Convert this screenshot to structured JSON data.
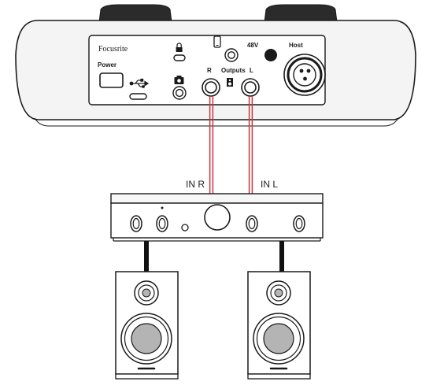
{
  "interface": {
    "brand": "Focusrite",
    "power_label": "Power",
    "phantom_label": "48V",
    "host_label": "Host",
    "outputs_label": "Outputs",
    "output_r_label": "R",
    "output_l_label": "L"
  },
  "amplifier": {
    "input_r_label": "IN R",
    "input_l_label": "IN L"
  },
  "colors": {
    "cable": "#c8373d",
    "outline": "#1a1a1a",
    "device_body": "#f4f4f4",
    "stand": "#111111"
  },
  "icons": [
    "lock-icon",
    "usb-icon",
    "usb-c-port-icon",
    "camera-icon",
    "phone-icon",
    "speaker-icon",
    "xlr-connector-icon",
    "knob-icon",
    "volume-knob-icon"
  ]
}
